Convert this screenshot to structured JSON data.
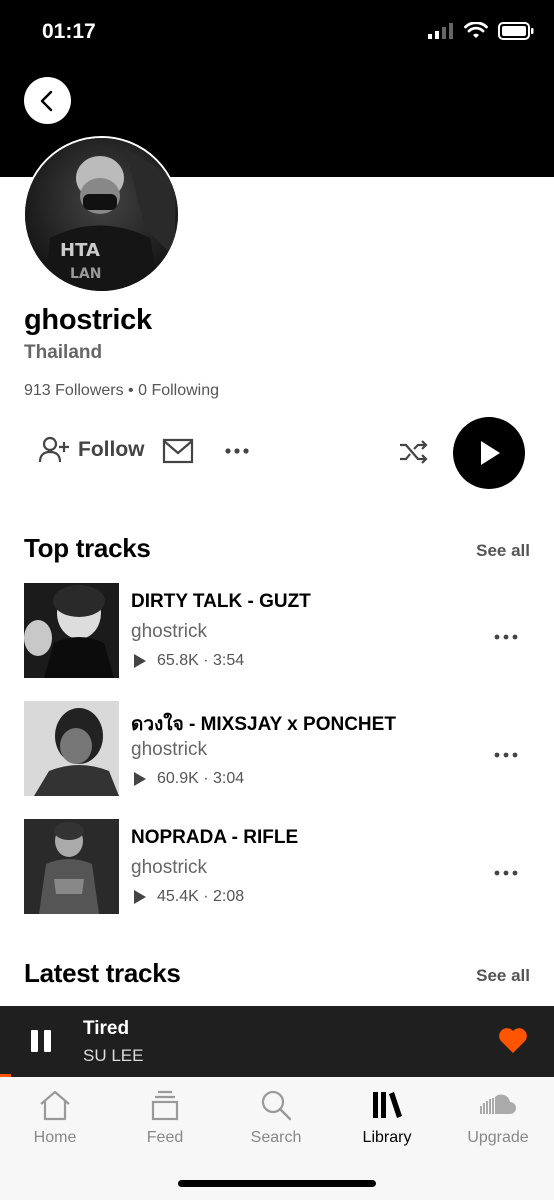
{
  "status_bar": {
    "time": "01:17"
  },
  "profile": {
    "name": "ghostrick",
    "country": "Thailand",
    "stats": "913 Followers • 0 Following"
  },
  "actions": {
    "follow_label": "Follow"
  },
  "top_tracks": {
    "title": "Top tracks",
    "see_all": "See all",
    "items": [
      {
        "title": "DIRTY TALK - GUZT",
        "artist": "ghostrick",
        "plays": "65.8K",
        "duration": "3:54"
      },
      {
        "title": "ดวงใจ - MIXSJAY x PONCHET",
        "artist": "ghostrick",
        "plays": "60.9K",
        "duration": "3:04"
      },
      {
        "title": "NOPRADA - RIFLE",
        "artist": "ghostrick",
        "plays": "45.4K",
        "duration": "2:08"
      }
    ]
  },
  "latest_tracks": {
    "title": "Latest tracks",
    "see_all": "See all"
  },
  "mini_player": {
    "title": "Tired",
    "artist": "SU LEE",
    "progress": 0.02
  },
  "tabs": [
    {
      "label": "Home",
      "icon": "home-icon"
    },
    {
      "label": "Feed",
      "icon": "feed-icon"
    },
    {
      "label": "Search",
      "icon": "search-icon"
    },
    {
      "label": "Library",
      "icon": "library-icon",
      "active": true
    },
    {
      "label": "Upgrade",
      "icon": "soundcloud-icon"
    }
  ],
  "colors": {
    "accent": "#ff5500",
    "header": "#000000",
    "player_bg": "#1f1f1f"
  }
}
